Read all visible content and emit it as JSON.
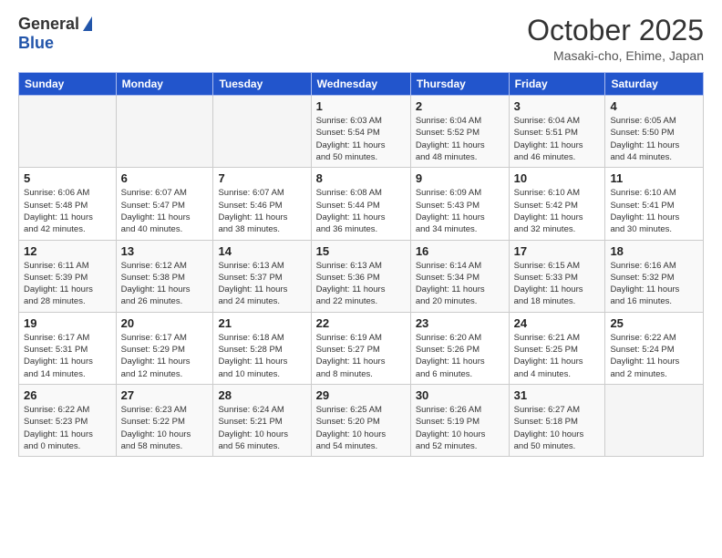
{
  "logo": {
    "general": "General",
    "blue": "Blue"
  },
  "header": {
    "month": "October 2025",
    "location": "Masaki-cho, Ehime, Japan"
  },
  "weekdays": [
    "Sunday",
    "Monday",
    "Tuesday",
    "Wednesday",
    "Thursday",
    "Friday",
    "Saturday"
  ],
  "weeks": [
    [
      {
        "day": "",
        "info": ""
      },
      {
        "day": "",
        "info": ""
      },
      {
        "day": "",
        "info": ""
      },
      {
        "day": "1",
        "info": "Sunrise: 6:03 AM\nSunset: 5:54 PM\nDaylight: 11 hours\nand 50 minutes."
      },
      {
        "day": "2",
        "info": "Sunrise: 6:04 AM\nSunset: 5:52 PM\nDaylight: 11 hours\nand 48 minutes."
      },
      {
        "day": "3",
        "info": "Sunrise: 6:04 AM\nSunset: 5:51 PM\nDaylight: 11 hours\nand 46 minutes."
      },
      {
        "day": "4",
        "info": "Sunrise: 6:05 AM\nSunset: 5:50 PM\nDaylight: 11 hours\nand 44 minutes."
      }
    ],
    [
      {
        "day": "5",
        "info": "Sunrise: 6:06 AM\nSunset: 5:48 PM\nDaylight: 11 hours\nand 42 minutes."
      },
      {
        "day": "6",
        "info": "Sunrise: 6:07 AM\nSunset: 5:47 PM\nDaylight: 11 hours\nand 40 minutes."
      },
      {
        "day": "7",
        "info": "Sunrise: 6:07 AM\nSunset: 5:46 PM\nDaylight: 11 hours\nand 38 minutes."
      },
      {
        "day": "8",
        "info": "Sunrise: 6:08 AM\nSunset: 5:44 PM\nDaylight: 11 hours\nand 36 minutes."
      },
      {
        "day": "9",
        "info": "Sunrise: 6:09 AM\nSunset: 5:43 PM\nDaylight: 11 hours\nand 34 minutes."
      },
      {
        "day": "10",
        "info": "Sunrise: 6:10 AM\nSunset: 5:42 PM\nDaylight: 11 hours\nand 32 minutes."
      },
      {
        "day": "11",
        "info": "Sunrise: 6:10 AM\nSunset: 5:41 PM\nDaylight: 11 hours\nand 30 minutes."
      }
    ],
    [
      {
        "day": "12",
        "info": "Sunrise: 6:11 AM\nSunset: 5:39 PM\nDaylight: 11 hours\nand 28 minutes."
      },
      {
        "day": "13",
        "info": "Sunrise: 6:12 AM\nSunset: 5:38 PM\nDaylight: 11 hours\nand 26 minutes."
      },
      {
        "day": "14",
        "info": "Sunrise: 6:13 AM\nSunset: 5:37 PM\nDaylight: 11 hours\nand 24 minutes."
      },
      {
        "day": "15",
        "info": "Sunrise: 6:13 AM\nSunset: 5:36 PM\nDaylight: 11 hours\nand 22 minutes."
      },
      {
        "day": "16",
        "info": "Sunrise: 6:14 AM\nSunset: 5:34 PM\nDaylight: 11 hours\nand 20 minutes."
      },
      {
        "day": "17",
        "info": "Sunrise: 6:15 AM\nSunset: 5:33 PM\nDaylight: 11 hours\nand 18 minutes."
      },
      {
        "day": "18",
        "info": "Sunrise: 6:16 AM\nSunset: 5:32 PM\nDaylight: 11 hours\nand 16 minutes."
      }
    ],
    [
      {
        "day": "19",
        "info": "Sunrise: 6:17 AM\nSunset: 5:31 PM\nDaylight: 11 hours\nand 14 minutes."
      },
      {
        "day": "20",
        "info": "Sunrise: 6:17 AM\nSunset: 5:29 PM\nDaylight: 11 hours\nand 12 minutes."
      },
      {
        "day": "21",
        "info": "Sunrise: 6:18 AM\nSunset: 5:28 PM\nDaylight: 11 hours\nand 10 minutes."
      },
      {
        "day": "22",
        "info": "Sunrise: 6:19 AM\nSunset: 5:27 PM\nDaylight: 11 hours\nand 8 minutes."
      },
      {
        "day": "23",
        "info": "Sunrise: 6:20 AM\nSunset: 5:26 PM\nDaylight: 11 hours\nand 6 minutes."
      },
      {
        "day": "24",
        "info": "Sunrise: 6:21 AM\nSunset: 5:25 PM\nDaylight: 11 hours\nand 4 minutes."
      },
      {
        "day": "25",
        "info": "Sunrise: 6:22 AM\nSunset: 5:24 PM\nDaylight: 11 hours\nand 2 minutes."
      }
    ],
    [
      {
        "day": "26",
        "info": "Sunrise: 6:22 AM\nSunset: 5:23 PM\nDaylight: 11 hours\nand 0 minutes."
      },
      {
        "day": "27",
        "info": "Sunrise: 6:23 AM\nSunset: 5:22 PM\nDaylight: 10 hours\nand 58 minutes."
      },
      {
        "day": "28",
        "info": "Sunrise: 6:24 AM\nSunset: 5:21 PM\nDaylight: 10 hours\nand 56 minutes."
      },
      {
        "day": "29",
        "info": "Sunrise: 6:25 AM\nSunset: 5:20 PM\nDaylight: 10 hours\nand 54 minutes."
      },
      {
        "day": "30",
        "info": "Sunrise: 6:26 AM\nSunset: 5:19 PM\nDaylight: 10 hours\nand 52 minutes."
      },
      {
        "day": "31",
        "info": "Sunrise: 6:27 AM\nSunset: 5:18 PM\nDaylight: 10 hours\nand 50 minutes."
      },
      {
        "day": "",
        "info": ""
      }
    ]
  ]
}
